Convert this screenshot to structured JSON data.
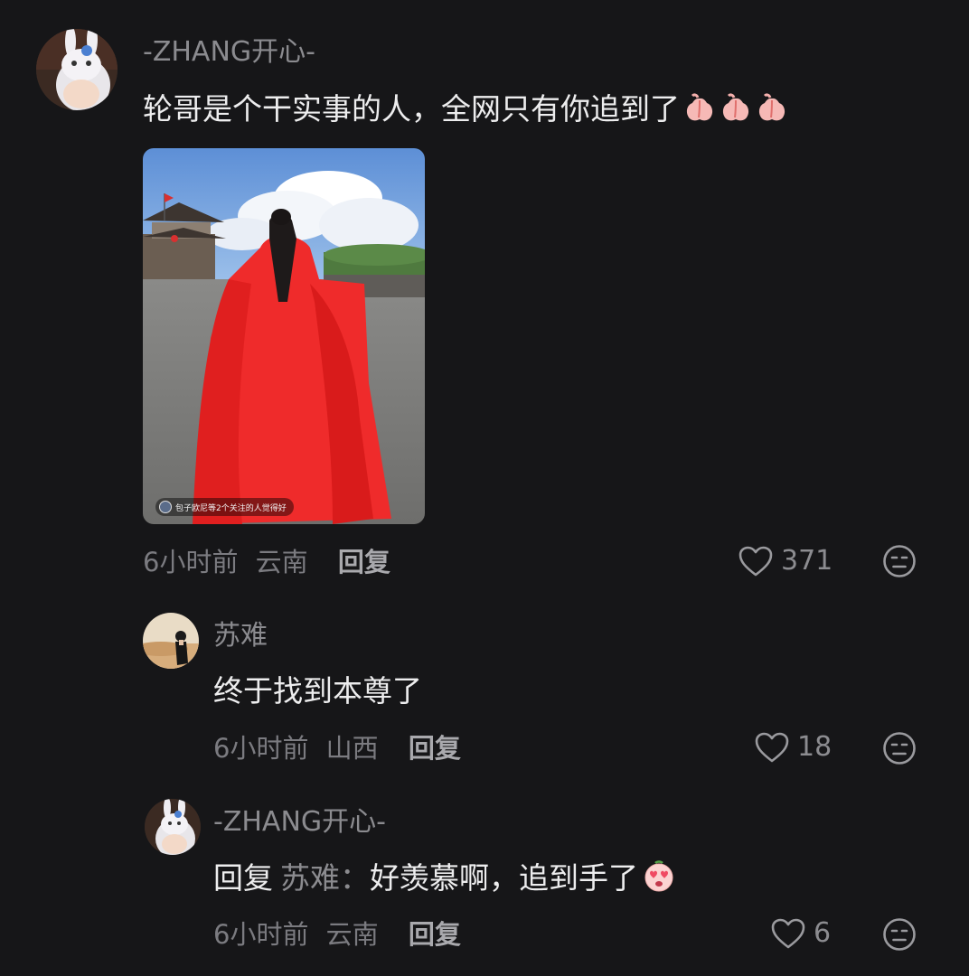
{
  "comments": [
    {
      "username": "-ZHANG开心-",
      "text": "轮哥是个干实事的人，全网只有你追到了",
      "emoji": "peach-emoji",
      "emoji_count": 3,
      "media_caption": "包子欧尼等2个关注的人觉得好",
      "time": "6小时前",
      "location": "云南",
      "reply_label": "回复",
      "likes": "371"
    },
    {
      "username": "苏难",
      "text": "终于找到本尊了",
      "time": "6小时前",
      "location": "山西",
      "reply_label": "回复",
      "likes": "18"
    },
    {
      "username": "-ZHANG开心-",
      "reply_prefix": "回复",
      "reply_target": "苏难：",
      "text": "好羡慕啊，追到手了",
      "emoji": "heart-eyes-emoji",
      "time": "6小时前",
      "location": "云南",
      "reply_label": "回复",
      "likes": "6"
    }
  ],
  "colors": {
    "background": "#161618",
    "username": "#8b8b8f",
    "text": "#ededee",
    "meta": "#7b7b80"
  },
  "icons": [
    "heart-outline-icon",
    "dislike-face-icon"
  ]
}
